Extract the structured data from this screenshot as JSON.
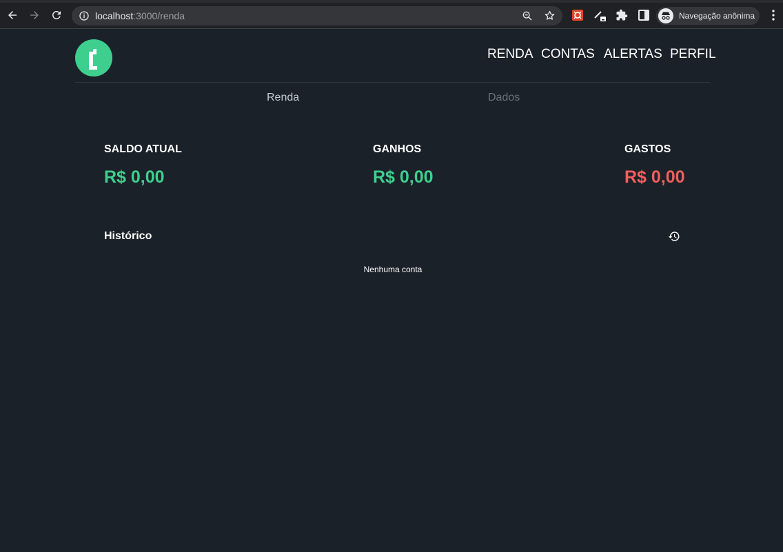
{
  "browser": {
    "url_host": "localhost",
    "url_path": ":3000/renda",
    "profile_label": "Navegação anônima"
  },
  "nav": {
    "items": [
      "RENDA",
      "CONTAS",
      "ALERTAS",
      "PERFIL"
    ],
    "active": "RENDA"
  },
  "subtabs": {
    "renda": "Renda",
    "dados": "Dados"
  },
  "stats": [
    {
      "label": "SALDO ATUAL",
      "value": "R$ 0,00",
      "color": "#3ecf8e"
    },
    {
      "label": "GANHOS",
      "value": "R$ 0,00",
      "color": "#3ecf8e"
    },
    {
      "label": "GASTOS",
      "value": "R$ 0,00",
      "color": "#f25f5c"
    }
  ],
  "history": {
    "title": "Histórico",
    "empty": "Nenhuma conta",
    "icon": "history-icon"
  },
  "colors": {
    "background": "#1b2129",
    "accent": "#3ecf8e",
    "negative": "#f25f5c"
  }
}
